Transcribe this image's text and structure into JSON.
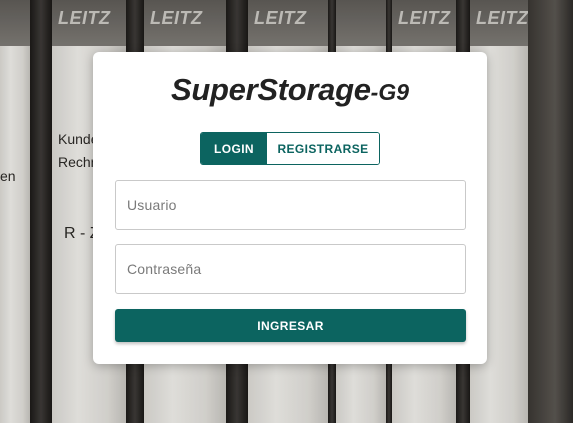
{
  "background": {
    "binder_brands": [
      "LEITZ",
      "LEITZ",
      "LEITZ",
      "LEITZ",
      "LEITZ"
    ],
    "binder_label_lines": [
      "Kunden-",
      "Rechnun",
      "R - Z"
    ],
    "left_edge_text": "en"
  },
  "app": {
    "title_main": "SuperStorage",
    "title_suffix": "-G9"
  },
  "tabs": {
    "login_label": "LOGIN",
    "register_label": "REGISTRARSE",
    "active": "LOGIN"
  },
  "form": {
    "username_placeholder": "Usuario",
    "username_value": "",
    "password_placeholder": "Contraseña",
    "password_value": "",
    "submit_label": "INGRESAR"
  },
  "colors": {
    "accent": "#0c6460",
    "card": "#ffffff",
    "title_text": "#222222"
  }
}
